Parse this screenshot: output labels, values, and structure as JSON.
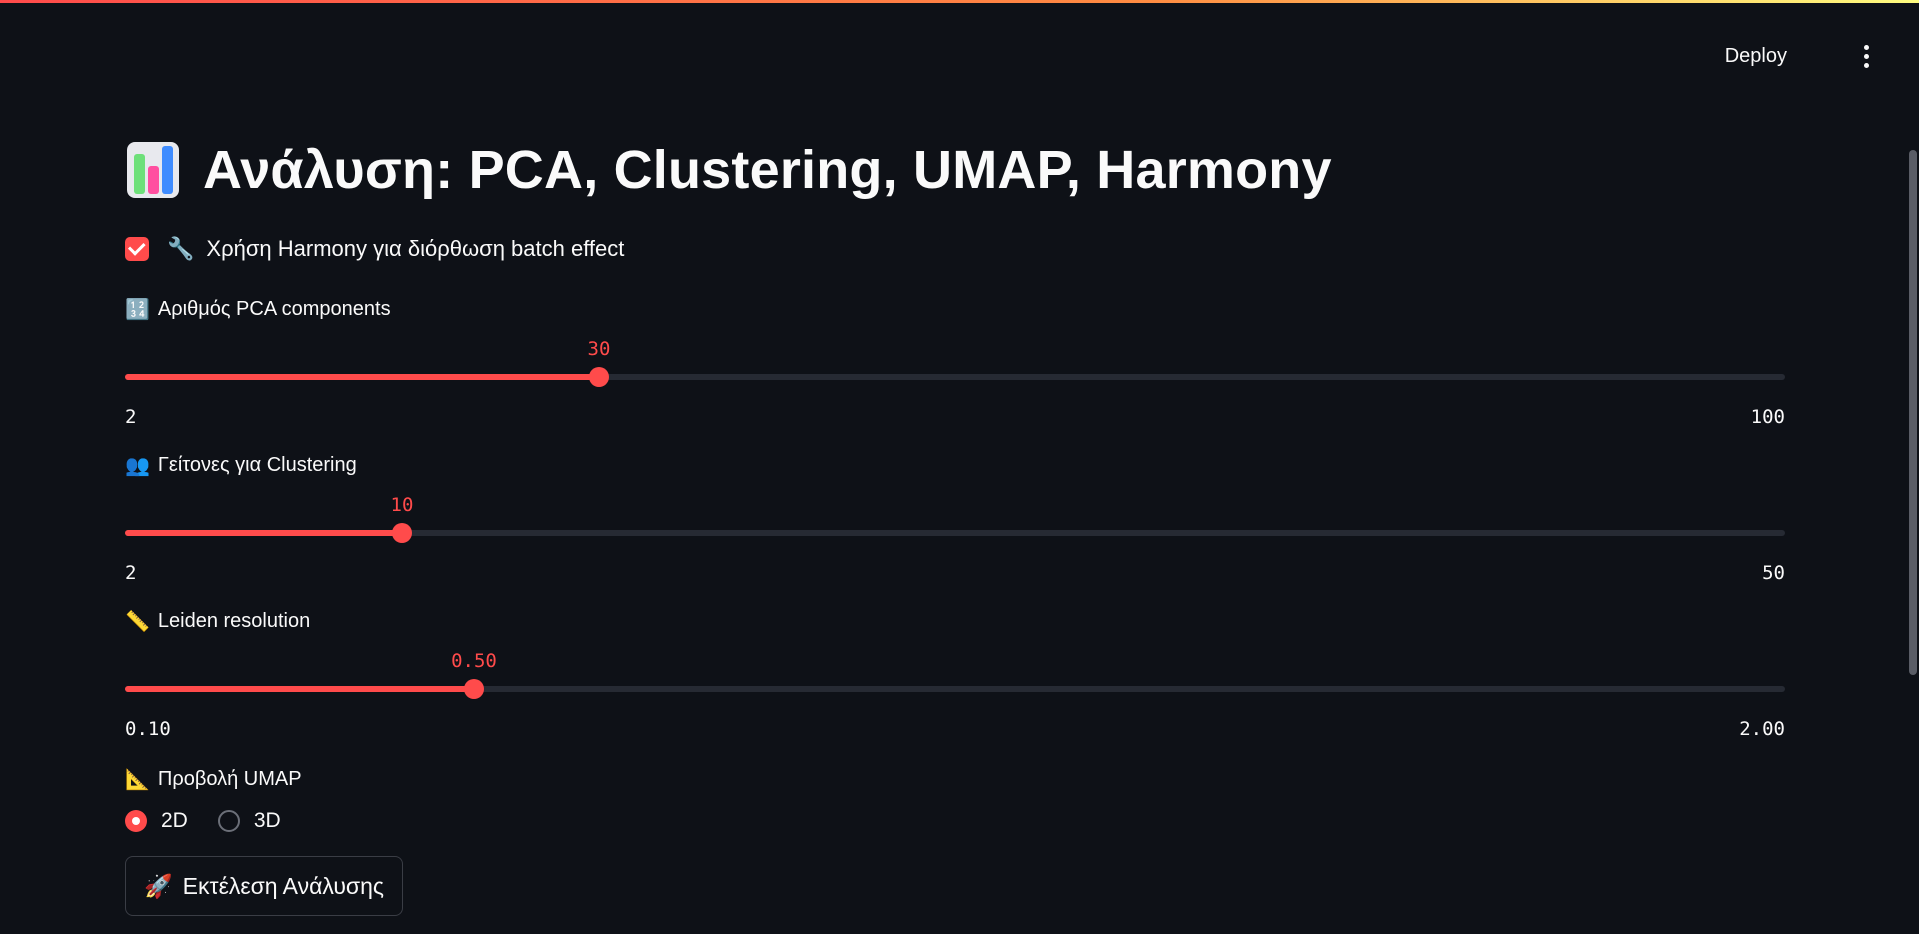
{
  "header": {
    "deploy_label": "Deploy",
    "menu_icon": "kebab-menu-icon"
  },
  "main": {
    "title_icon": "bar-chart-icon",
    "title": "Ανάλυση: PCA, Clustering, UMAP, Harmony",
    "harmony_checkbox": {
      "checked": true,
      "icon": "🔧",
      "label": "Χρήση Harmony για διόρθωση batch effect"
    },
    "sliders": [
      {
        "icon": "🔢",
        "label": "Αριθμός PCA components",
        "value": "30",
        "min": "2",
        "max": "100",
        "fraction": 0.2857
      },
      {
        "icon": "👥",
        "label": "Γείτονες για Clustering",
        "value": "10",
        "min": "2",
        "max": "50",
        "fraction": 0.1667
      },
      {
        "icon": "📏",
        "label": "Leiden resolution",
        "value": "0.50",
        "min": "0.10",
        "max": "2.00",
        "fraction": 0.2105
      }
    ],
    "umap_view": {
      "icon": "📐",
      "label": "Προβολή UMAP",
      "options": [
        "2D",
        "3D"
      ],
      "selected": "2D"
    },
    "run_button": {
      "icon": "🚀",
      "label": "Εκτέλεση Ανάλυσης"
    }
  },
  "colors": {
    "background": "#0e1117",
    "accent": "#ff4b4b",
    "text": "#fafafa",
    "track": "#262a33"
  }
}
